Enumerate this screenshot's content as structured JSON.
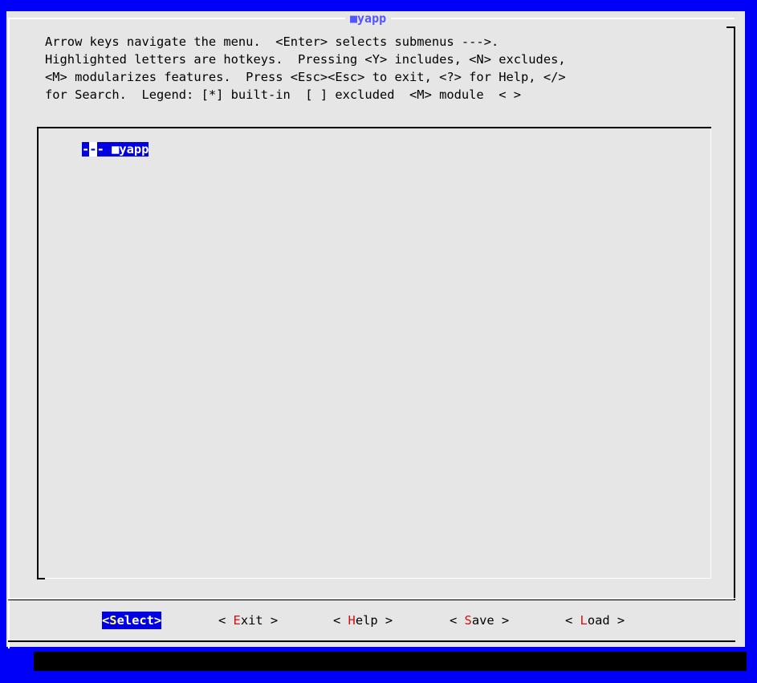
{
  "dialog": {
    "title": "■yapp",
    "help_lines": [
      "Arrow keys navigate the menu.  <Enter> selects submenus --->.",
      "Highlighted letters are hotkeys.  Pressing <Y> includes, <N> excludes,",
      "<M> modularizes features.  Press <Esc><Esc> to exit, <?> for Help, </>",
      "for Search.  Legend: [*] built-in  [ ] excluded  <M> module  < >"
    ]
  },
  "menu": {
    "items": [
      {
        "prefix_left": "-",
        "prefix_mid": "-",
        "prefix_right": "-",
        "label": " ■yapp"
      }
    ]
  },
  "buttons": [
    {
      "open": "<",
      "key": "S",
      "rest": "elect",
      "close": ">",
      "selected": true
    },
    {
      "open": "< ",
      "key": "E",
      "rest": "xit",
      "close": " >",
      "selected": false
    },
    {
      "open": "< ",
      "key": "H",
      "rest": "elp",
      "close": " >",
      "selected": false
    },
    {
      "open": "< ",
      "key": "S",
      "rest": "ave",
      "close": " >",
      "selected": false
    },
    {
      "open": "< ",
      "key": "L",
      "rest": "oad",
      "close": " >",
      "selected": false
    }
  ],
  "colors": {
    "screen_bg": "#0000f8",
    "dialog_bg": "#e6e6e6",
    "title": "#5555ff",
    "highlight_bg": "#0000e0",
    "hotkey": "#d01010",
    "selected_hotkey": "#ffff55"
  }
}
